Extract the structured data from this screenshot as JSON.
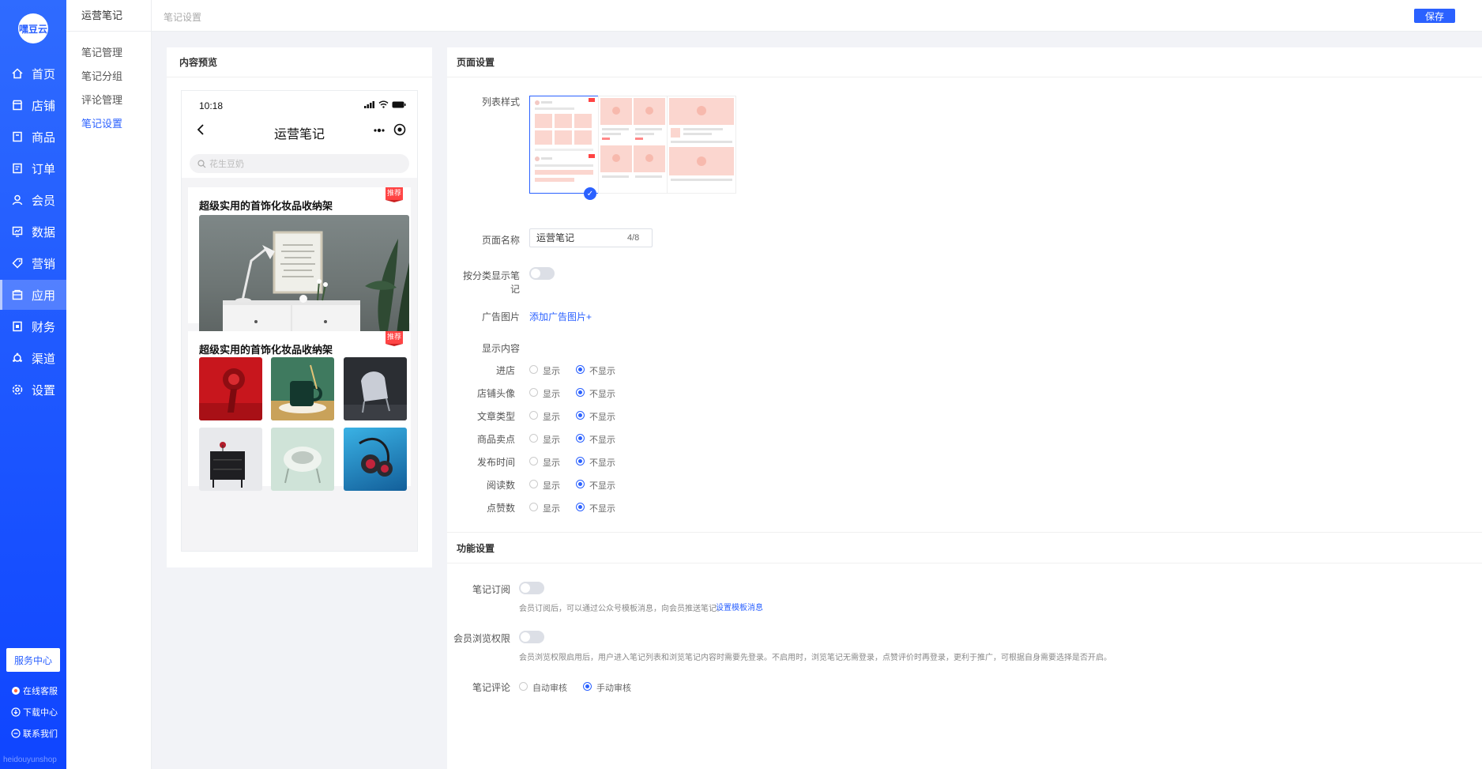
{
  "app": {
    "logo_text": "嘿豆云"
  },
  "nav": {
    "items": [
      {
        "label": "首页",
        "icon": "home-icon"
      },
      {
        "label": "店铺",
        "icon": "store-icon"
      },
      {
        "label": "商品",
        "icon": "goods-icon"
      },
      {
        "label": "订单",
        "icon": "order-icon"
      },
      {
        "label": "会员",
        "icon": "member-icon"
      },
      {
        "label": "数据",
        "icon": "data-icon"
      },
      {
        "label": "营销",
        "icon": "tag-icon"
      },
      {
        "label": "应用",
        "icon": "app-icon"
      },
      {
        "label": "财务",
        "icon": "finance-icon"
      },
      {
        "label": "渠道",
        "icon": "channel-icon"
      },
      {
        "label": "设置",
        "icon": "gear-icon"
      }
    ],
    "active": "应用",
    "service_button": "服务中心",
    "links": [
      "在线客服",
      "下载中心",
      "联系我们"
    ],
    "footer": "heidouyunshop"
  },
  "subnav": {
    "title": "运营笔记",
    "items": [
      "笔记管理",
      "笔记分组",
      "评论管理",
      "笔记设置"
    ],
    "active": "笔记设置"
  },
  "topbar": {
    "breadcrumb": "笔记设置",
    "save_label": "保存"
  },
  "preview": {
    "title": "内容预览",
    "phone": {
      "time": "10:18",
      "page_title": "运营笔记",
      "search_placeholder": "花生豆奶",
      "notes": [
        {
          "title": "超级实用的首饰化妆品收纳架",
          "tag": "推荐"
        },
        {
          "title": "超级实用的首饰化妆品收纳架",
          "tag": "推荐"
        }
      ]
    }
  },
  "page_settings": {
    "title": "页面设置",
    "list_style_label": "列表样式",
    "page_name_label": "页面名称",
    "page_name_value": "运营笔记",
    "page_name_count": "4/8",
    "category_toggle_label": "按分类显示笔记",
    "ad_image_label": "广告图片",
    "ad_image_link": "添加广告图片+",
    "display_content_label": "显示内容",
    "option_show": "显示",
    "option_hide": "不显示",
    "display_rows": [
      {
        "label": "进店",
        "value": "不显示"
      },
      {
        "label": "店铺头像",
        "value": "不显示"
      },
      {
        "label": "文章类型",
        "value": "不显示"
      },
      {
        "label": "商品卖点",
        "value": "不显示"
      },
      {
        "label": "发布时间",
        "value": "不显示"
      },
      {
        "label": "阅读数",
        "value": "不显示"
      },
      {
        "label": "点赞数",
        "value": "不显示"
      }
    ]
  },
  "function_settings": {
    "title": "功能设置",
    "subscribe_label": "笔记订阅",
    "subscribe_help": "会员订阅后，可以通过公众号模板消息，向会员推送笔记。",
    "subscribe_link": "设置模板消息",
    "permission_label": "会员浏览权限",
    "permission_help": "会员浏览权限启用后，用户进入笔记列表和浏览笔记内容时需要先登录。不启用时，浏览笔记无需登录，点赞评价时再登录，更利于推广，可根据自身需要选择是否开启。",
    "comment_label": "笔记评论",
    "comment_auto": "自动审核",
    "comment_manual": "手动审核",
    "comment_value": "手动审核"
  },
  "colors": {
    "brand": "#2b61ff",
    "tag_red": "#f44444"
  }
}
